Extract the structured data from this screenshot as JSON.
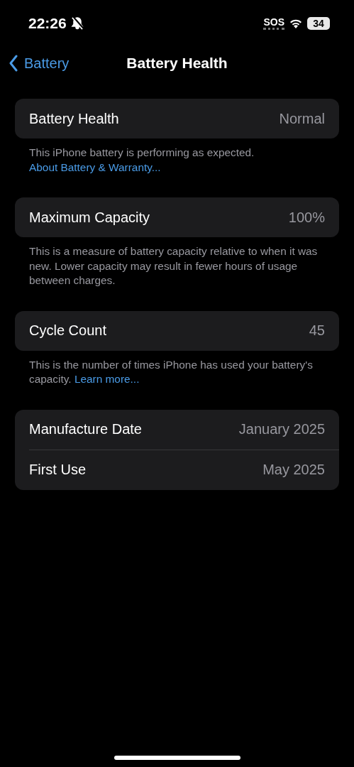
{
  "status_bar": {
    "time": "22:26",
    "sos": "SOS",
    "battery": "34"
  },
  "nav": {
    "back": "Battery",
    "title": "Battery Health"
  },
  "sections": [
    {
      "rows": [
        {
          "label": "Battery Health",
          "value": "Normal"
        }
      ],
      "footer": {
        "text": "This iPhone battery is performing as expected.",
        "link": "About Battery & Warranty..."
      }
    },
    {
      "rows": [
        {
          "label": "Maximum Capacity",
          "value": "100%"
        }
      ],
      "footer": {
        "text": "This is a measure of battery capacity relative to when it was new. Lower capacity may result in fewer hours of usage between charges."
      }
    },
    {
      "rows": [
        {
          "label": "Cycle Count",
          "value": "45"
        }
      ],
      "footer": {
        "text": "This is the number of times iPhone has used your battery's capacity.",
        "link": "Learn more..."
      }
    },
    {
      "rows": [
        {
          "label": "Manufacture Date",
          "value": "January 2025"
        },
        {
          "label": "First Use",
          "value": "May 2025"
        }
      ]
    }
  ]
}
